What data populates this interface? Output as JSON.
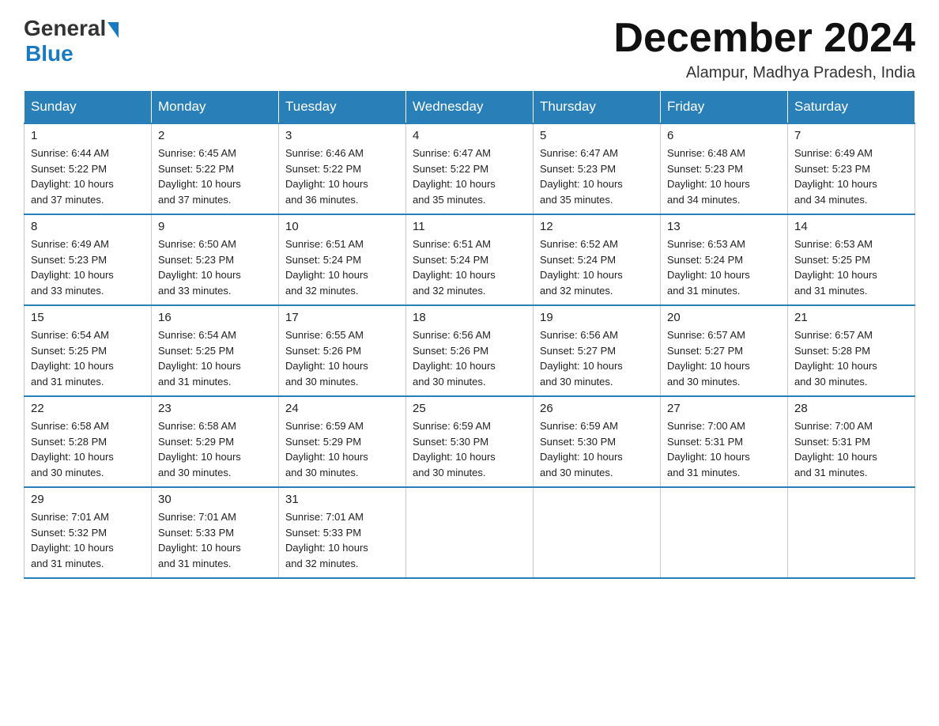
{
  "header": {
    "logo_general": "General",
    "logo_blue": "Blue",
    "month_title": "December 2024",
    "location": "Alampur, Madhya Pradesh, India"
  },
  "days_of_week": [
    "Sunday",
    "Monday",
    "Tuesday",
    "Wednesday",
    "Thursday",
    "Friday",
    "Saturday"
  ],
  "weeks": [
    [
      {
        "day": "1",
        "sunrise": "6:44 AM",
        "sunset": "5:22 PM",
        "daylight": "10 hours and 37 minutes."
      },
      {
        "day": "2",
        "sunrise": "6:45 AM",
        "sunset": "5:22 PM",
        "daylight": "10 hours and 37 minutes."
      },
      {
        "day": "3",
        "sunrise": "6:46 AM",
        "sunset": "5:22 PM",
        "daylight": "10 hours and 36 minutes."
      },
      {
        "day": "4",
        "sunrise": "6:47 AM",
        "sunset": "5:22 PM",
        "daylight": "10 hours and 35 minutes."
      },
      {
        "day": "5",
        "sunrise": "6:47 AM",
        "sunset": "5:23 PM",
        "daylight": "10 hours and 35 minutes."
      },
      {
        "day": "6",
        "sunrise": "6:48 AM",
        "sunset": "5:23 PM",
        "daylight": "10 hours and 34 minutes."
      },
      {
        "day": "7",
        "sunrise": "6:49 AM",
        "sunset": "5:23 PM",
        "daylight": "10 hours and 34 minutes."
      }
    ],
    [
      {
        "day": "8",
        "sunrise": "6:49 AM",
        "sunset": "5:23 PM",
        "daylight": "10 hours and 33 minutes."
      },
      {
        "day": "9",
        "sunrise": "6:50 AM",
        "sunset": "5:23 PM",
        "daylight": "10 hours and 33 minutes."
      },
      {
        "day": "10",
        "sunrise": "6:51 AM",
        "sunset": "5:24 PM",
        "daylight": "10 hours and 32 minutes."
      },
      {
        "day": "11",
        "sunrise": "6:51 AM",
        "sunset": "5:24 PM",
        "daylight": "10 hours and 32 minutes."
      },
      {
        "day": "12",
        "sunrise": "6:52 AM",
        "sunset": "5:24 PM",
        "daylight": "10 hours and 32 minutes."
      },
      {
        "day": "13",
        "sunrise": "6:53 AM",
        "sunset": "5:24 PM",
        "daylight": "10 hours and 31 minutes."
      },
      {
        "day": "14",
        "sunrise": "6:53 AM",
        "sunset": "5:25 PM",
        "daylight": "10 hours and 31 minutes."
      }
    ],
    [
      {
        "day": "15",
        "sunrise": "6:54 AM",
        "sunset": "5:25 PM",
        "daylight": "10 hours and 31 minutes."
      },
      {
        "day": "16",
        "sunrise": "6:54 AM",
        "sunset": "5:25 PM",
        "daylight": "10 hours and 31 minutes."
      },
      {
        "day": "17",
        "sunrise": "6:55 AM",
        "sunset": "5:26 PM",
        "daylight": "10 hours and 30 minutes."
      },
      {
        "day": "18",
        "sunrise": "6:56 AM",
        "sunset": "5:26 PM",
        "daylight": "10 hours and 30 minutes."
      },
      {
        "day": "19",
        "sunrise": "6:56 AM",
        "sunset": "5:27 PM",
        "daylight": "10 hours and 30 minutes."
      },
      {
        "day": "20",
        "sunrise": "6:57 AM",
        "sunset": "5:27 PM",
        "daylight": "10 hours and 30 minutes."
      },
      {
        "day": "21",
        "sunrise": "6:57 AM",
        "sunset": "5:28 PM",
        "daylight": "10 hours and 30 minutes."
      }
    ],
    [
      {
        "day": "22",
        "sunrise": "6:58 AM",
        "sunset": "5:28 PM",
        "daylight": "10 hours and 30 minutes."
      },
      {
        "day": "23",
        "sunrise": "6:58 AM",
        "sunset": "5:29 PM",
        "daylight": "10 hours and 30 minutes."
      },
      {
        "day": "24",
        "sunrise": "6:59 AM",
        "sunset": "5:29 PM",
        "daylight": "10 hours and 30 minutes."
      },
      {
        "day": "25",
        "sunrise": "6:59 AM",
        "sunset": "5:30 PM",
        "daylight": "10 hours and 30 minutes."
      },
      {
        "day": "26",
        "sunrise": "6:59 AM",
        "sunset": "5:30 PM",
        "daylight": "10 hours and 30 minutes."
      },
      {
        "day": "27",
        "sunrise": "7:00 AM",
        "sunset": "5:31 PM",
        "daylight": "10 hours and 31 minutes."
      },
      {
        "day": "28",
        "sunrise": "7:00 AM",
        "sunset": "5:31 PM",
        "daylight": "10 hours and 31 minutes."
      }
    ],
    [
      {
        "day": "29",
        "sunrise": "7:01 AM",
        "sunset": "5:32 PM",
        "daylight": "10 hours and 31 minutes."
      },
      {
        "day": "30",
        "sunrise": "7:01 AM",
        "sunset": "5:33 PM",
        "daylight": "10 hours and 31 minutes."
      },
      {
        "day": "31",
        "sunrise": "7:01 AM",
        "sunset": "5:33 PM",
        "daylight": "10 hours and 32 minutes."
      },
      null,
      null,
      null,
      null
    ]
  ],
  "labels": {
    "sunrise": "Sunrise:",
    "sunset": "Sunset:",
    "daylight": "Daylight: 10 hours"
  }
}
